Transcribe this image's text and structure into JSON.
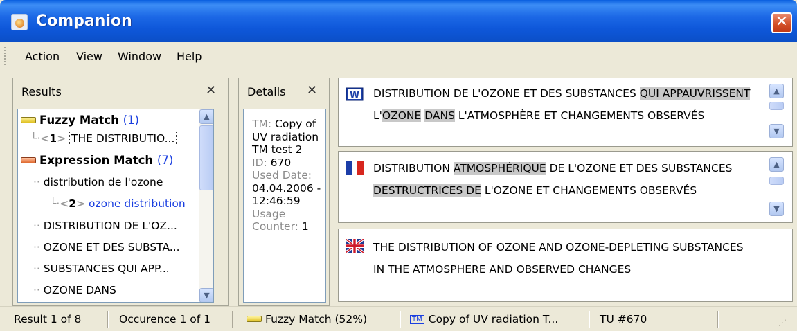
{
  "window": {
    "title": "Companion",
    "close_label": "✕"
  },
  "menu": {
    "items": [
      "Action",
      "View",
      "Window",
      "Help"
    ]
  },
  "results": {
    "header": "Results",
    "close_label": "✕",
    "groups": [
      {
        "label": "Fuzzy Match",
        "count": "(1)"
      },
      {
        "label": "Expression Match",
        "count": "(7)"
      }
    ],
    "items": [
      {
        "num": "1",
        "text": "THE DISTRIBUTIO..."
      },
      {
        "text": "distribution de l'ozone"
      },
      {
        "num": "2",
        "text": "ozone distribution"
      },
      {
        "text": "DISTRIBUTION DE L'OZ..."
      },
      {
        "text": "OZONE ET DES SUBSTA..."
      },
      {
        "text": "SUBSTANCES QUI APP..."
      },
      {
        "text": "OZONE DANS"
      }
    ]
  },
  "details": {
    "header": "Details",
    "close_label": "✕",
    "tm_label": "TM:",
    "tm_value": "Copy of UV radiation TM test 2",
    "id_label": "ID:",
    "id_value": "670",
    "used_date_label": "Used Date:",
    "used_date_value": "04.04.2006 - 12:46:59",
    "usage_label": "Usage Counter:",
    "usage_value": "1"
  },
  "segments": {
    "source": {
      "icon": "word-document-icon",
      "parts": [
        {
          "t": "DISTRIBUTION DE L'OZONE ET DES SUBSTANCES ",
          "h": false
        },
        {
          "t": "QUI APPAUVRISSENT",
          "h": true
        },
        {
          "t": " L'",
          "h": false
        },
        {
          "t": "OZONE",
          "h": true
        },
        {
          "t": " ",
          "h": false
        },
        {
          "t": "DANS",
          "h": true
        },
        {
          "t": " L'ATMOSPHÈRE ET CHANGEMENTS OBSERVÉS",
          "h": false
        }
      ]
    },
    "french": {
      "icon": "french-flag-icon",
      "parts": [
        {
          "t": "DISTRIBUTION ",
          "h": false
        },
        {
          "t": "ATMOSPHÉRIQUE",
          "h": true
        },
        {
          "t": " DE L'OZONE ET DES SUBSTANCES ",
          "h": false
        },
        {
          "t": "DESTRUCTRICES DE",
          "h": true
        },
        {
          "t": " L'OZONE ET CHANGEMENTS OBSERVÉS",
          "h": false
        }
      ]
    },
    "english": {
      "icon": "uk-flag-icon",
      "text": "THE DISTRIBUTION OF OZONE AND OZONE-DEPLETING SUBSTANCES IN THE ATMOSPHERE AND OBSERVED CHANGES"
    }
  },
  "status": {
    "result": "Result 1 of 8",
    "occurence": "Occurence 1 of 1",
    "match": "Fuzzy Match (52%)",
    "tm_badge": "TM",
    "tm": "Copy of UV radiation T...",
    "tu": "TU #670"
  }
}
